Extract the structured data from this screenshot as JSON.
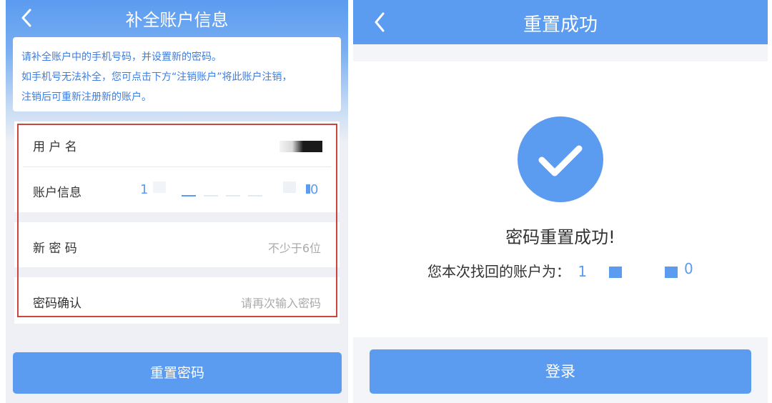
{
  "left_screen": {
    "title": "补全账户信息",
    "notice_lines": [
      "请补全账户中的手机号码，并设置新的密码。",
      "如手机号无法补全，您可点击下方“注销账户”将此账户注销，",
      "注销后可重新注册新的账户。"
    ],
    "fields": {
      "username_label": "用 户 名",
      "account_label": "账户信息",
      "account_value_start": "1",
      "account_value_end": "0",
      "new_password_label": "新 密 码",
      "new_password_placeholder": "不少于6位",
      "confirm_label": "密码确认",
      "confirm_placeholder": "请再次输入密码"
    },
    "reset_button": "重置密码"
  },
  "right_screen": {
    "title": "重置成功",
    "success_message": "密码重置成功!",
    "account_prefix": "您本次找回的账户为：",
    "account_value_start": "1",
    "account_value_end": "0",
    "login_button": "登录"
  },
  "colors": {
    "primary": "#5b9bf0",
    "highlight_border": "#c84640",
    "notice_text": "#3c7de0"
  },
  "icons": {
    "back": "chevron-left-icon",
    "success": "check-circle-icon"
  }
}
